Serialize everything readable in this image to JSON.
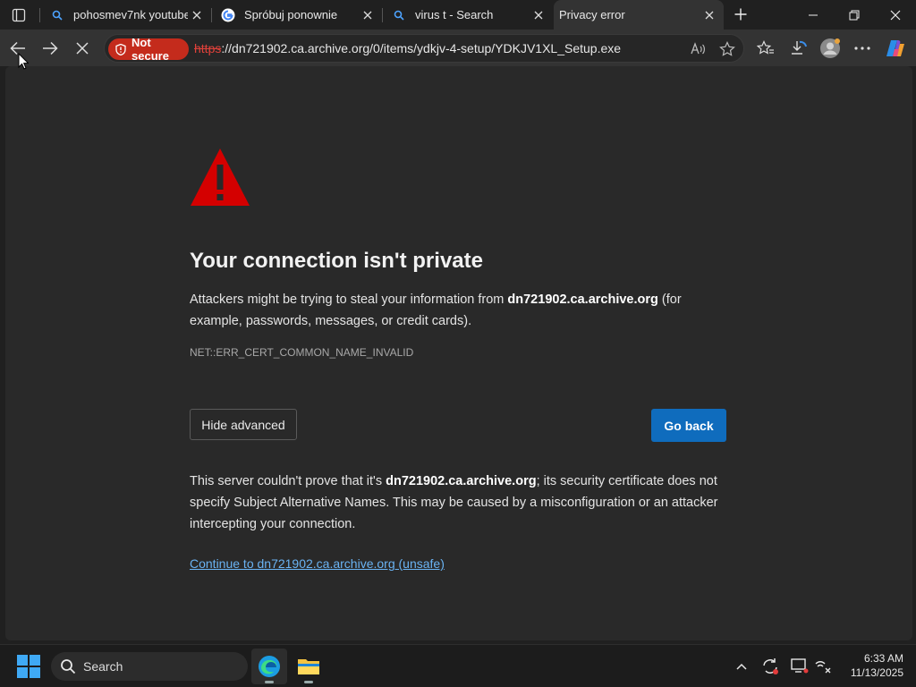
{
  "tabs": [
    {
      "title": "pohosmev7nk youtube -",
      "favicon": "search-icon"
    },
    {
      "title": "Spróbuj ponownie",
      "favicon": "google-icon"
    },
    {
      "title": "virus t - Search",
      "favicon": "search-icon"
    },
    {
      "title": "Privacy error",
      "favicon": "none",
      "active": true
    }
  ],
  "toolbar": {
    "security_chip": "Not secure",
    "url_scheme": "https",
    "url_rest": "://dn721902.ca.archive.org/0/items/ydkjv-4-setup/YDKJV1XL_Setup.exe"
  },
  "page": {
    "heading": "Your connection isn't private",
    "intro_before": "Attackers might be trying to steal your information from ",
    "intro_host": "dn721902.ca.archive.org",
    "intro_after": " (for example, passwords, messages, or credit cards).",
    "error_code": "NET::ERR_CERT_COMMON_NAME_INVALID",
    "hide_advanced": "Hide advanced",
    "go_back": "Go back",
    "detail_before": "This server couldn't prove that it's ",
    "detail_host": "dn721902.ca.archive.org",
    "detail_after": "; its security certificate does not specify Subject Alternative Names. This may be caused by a misconfiguration or an attacker intercepting your connection.",
    "continue_link": "Continue to dn721902.ca.archive.org (unsafe)"
  },
  "taskbar": {
    "search_label": "Search",
    "time": "6:33 AM",
    "date": "11/13/2025"
  },
  "colors": {
    "accent": "#0f6cbd",
    "danger": "#c42b1c",
    "link": "#6ab3f3",
    "warning_triangle": "#d40000"
  }
}
